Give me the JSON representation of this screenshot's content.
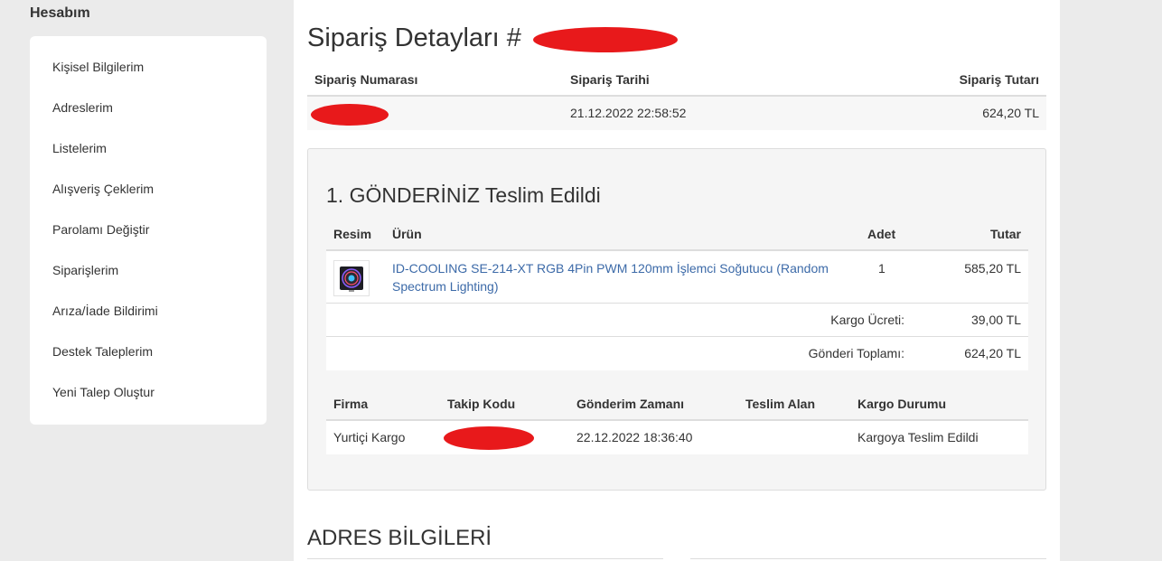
{
  "sidebar": {
    "title": "Hesabım",
    "items": [
      {
        "label": "Kişisel Bilgilerim"
      },
      {
        "label": "Adreslerim"
      },
      {
        "label": "Listelerim"
      },
      {
        "label": "Alışveriş Çeklerim"
      },
      {
        "label": "Parolamı Değiştir"
      },
      {
        "label": "Siparişlerim"
      },
      {
        "label": "Arıza/İade Bildirimi"
      },
      {
        "label": "Destek Taleplerim"
      },
      {
        "label": "Yeni Talep Oluştur"
      }
    ]
  },
  "order": {
    "title": "Sipariş Detayları #",
    "headers": {
      "number": "Sipariş Numarası",
      "date": "Sipariş Tarihi",
      "total": "Sipariş Tutarı"
    },
    "date": "21.12.2022 22:58:52",
    "total": "624,20 TL"
  },
  "shipment": {
    "title": "1. GÖNDERİNİZ Teslim Edildi",
    "product_headers": {
      "image": "Resim",
      "product": "Ürün",
      "qty": "Adet",
      "amount": "Tutar"
    },
    "product": {
      "name": "ID-COOLING SE-214-XT RGB 4Pin PWM 120mm İşlemci Soğutucu (Random Spectrum Lighting)",
      "qty": "1",
      "amount": "585,20 TL"
    },
    "cargo_fee_label": "Kargo Ücreti:",
    "cargo_fee": "39,00 TL",
    "shipment_total_label": "Gönderi Toplamı:",
    "shipment_total": "624,20 TL",
    "tracking_headers": {
      "company": "Firma",
      "tracking_code": "Takip Kodu",
      "sent_time": "Gönderim Zamanı",
      "receiver": "Teslim Alan",
      "status": "Kargo Durumu"
    },
    "tracking": {
      "company": "Yurtiçi Kargo",
      "sent_time": "22.12.2022 18:36:40",
      "receiver": "",
      "status": "Kargoya Teslim Edildi"
    }
  },
  "address": {
    "title": "ADRES BİLGİLERİ"
  },
  "colors": {
    "link": "#3c6aa8",
    "redaction": "#e8191b",
    "background": "#ebebeb"
  }
}
